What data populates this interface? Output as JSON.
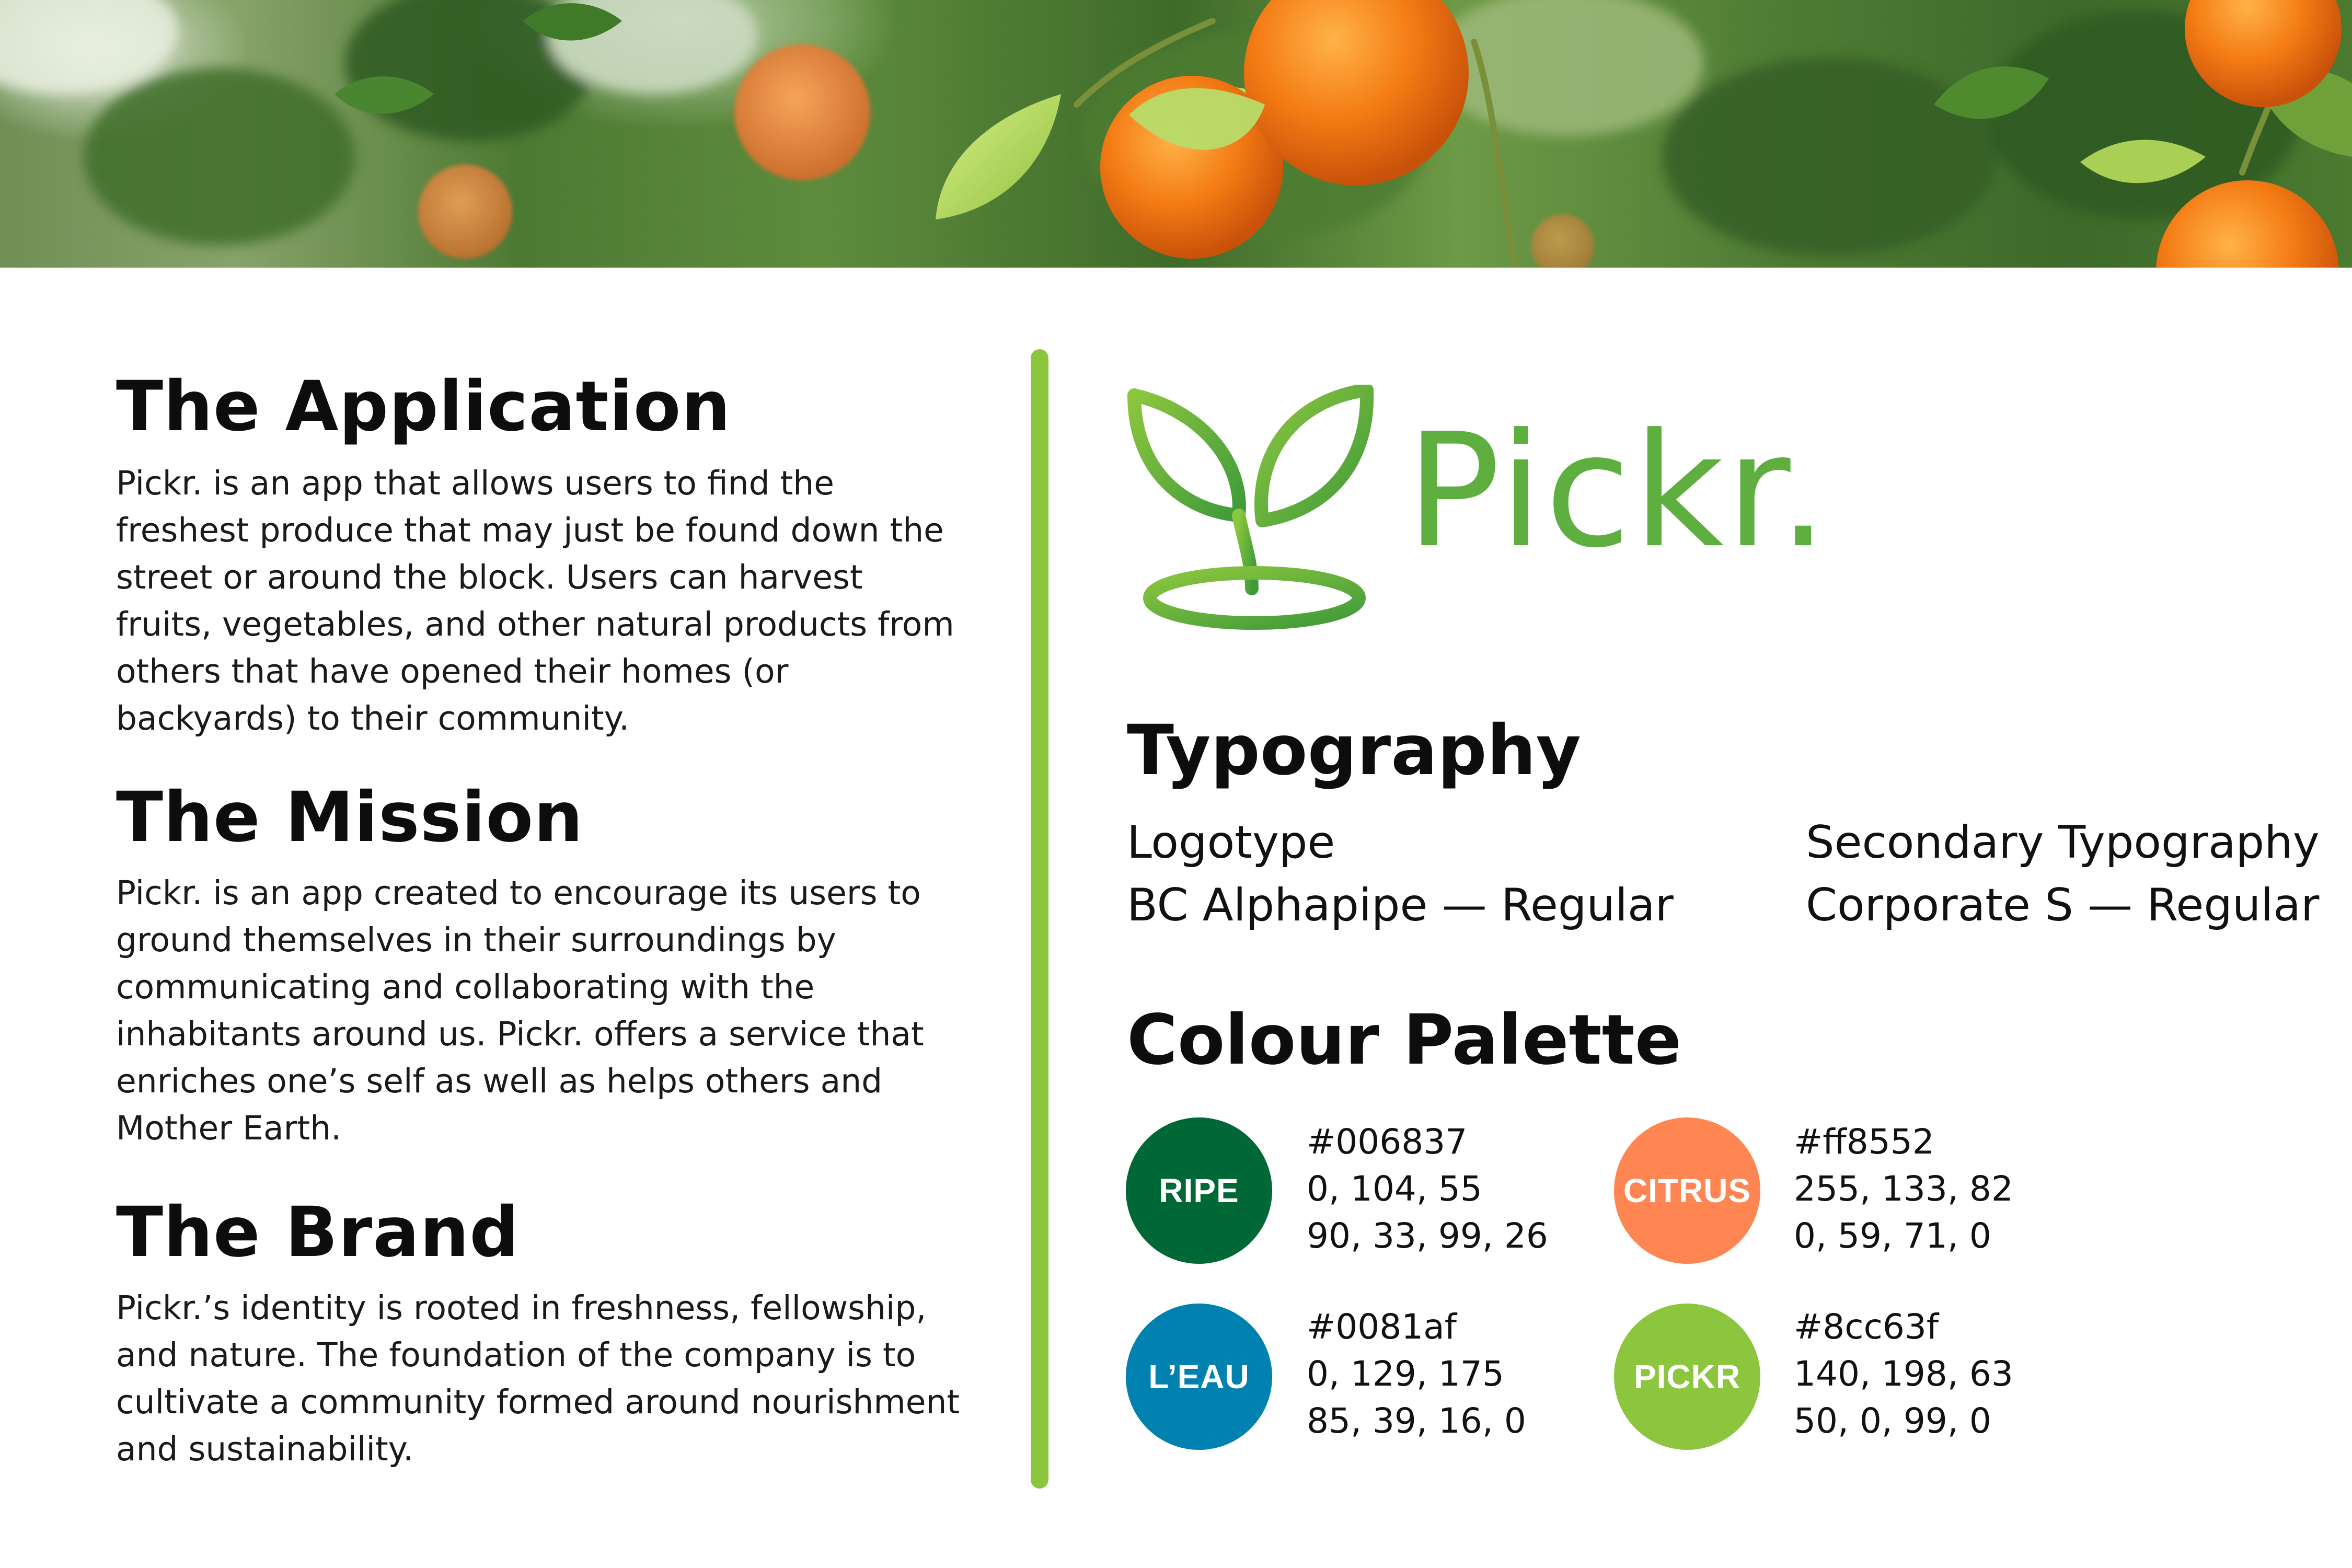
{
  "sections": [
    {
      "title": "The Application",
      "body": "Pickr. is an app that allows users to find the freshest produce that may just be found down the street or around the block. Users can harvest fruits, vegetables, and other natural products from others that have opened their homes (or backyards) to their community."
    },
    {
      "title": "The Mission",
      "body": "Pickr. is an app created to encourage its users to ground themselves in their surroundings by communicating and collaborating with the inhabitants around us. Pickr. offers a service that enriches one’s self as well as helps others and Mother Earth."
    },
    {
      "title": "The Brand",
      "body": "Pickr.’s identity is rooted in freshness, fellowship, and nature. The foundation of the company is to cultivate a community formed around nourishment and sustainability."
    }
  ],
  "logo": {
    "wordmark": "Pickr.",
    "icon": "sprout-icon",
    "color": "#5fae40"
  },
  "typography": {
    "title": "Typography",
    "primary_label": "Logotype",
    "primary_font": "BC Alphapipe — Regular",
    "secondary_label": "Secondary Typography",
    "secondary_font": "Corporate S — Regular"
  },
  "palette": {
    "title": "Colour Palette",
    "colors": [
      {
        "name": "RIPE",
        "hex": "#006837",
        "rgb": "0, 104, 55",
        "cmyk": "90, 33, 99, 26"
      },
      {
        "name": "CITRUS",
        "hex": "#ff8552",
        "rgb": "255, 133, 82",
        "cmyk": "0, 59, 71, 0"
      },
      {
        "name": "L’EAU",
        "hex": "#0081af",
        "rgb": "0, 129, 175",
        "cmyk": "85, 39, 16, 0"
      },
      {
        "name": "PICKR",
        "hex": "#8cc63f",
        "rgb": "140, 198, 63",
        "cmyk": "50, 0, 99, 0"
      }
    ]
  },
  "divider_color": "#8cc63f",
  "hero": {
    "icon": "orange-tree-photo"
  }
}
